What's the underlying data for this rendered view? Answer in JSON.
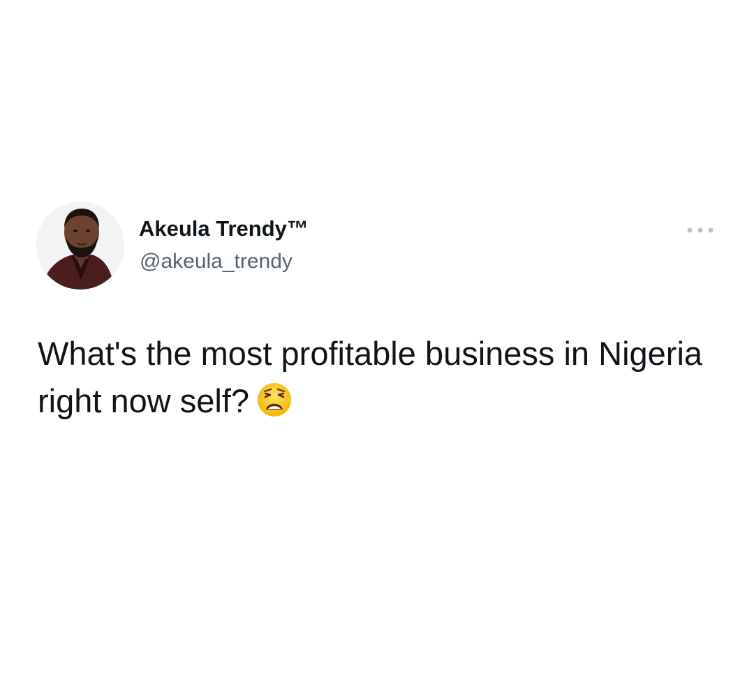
{
  "author": {
    "display_name": "Akeula Trendy™",
    "handle": "@akeula_trendy",
    "avatar_icon": "profile-photo"
  },
  "tweet": {
    "text": "What's the most profitable business in Nigeria right now self?",
    "emoji": "weary-face-icon"
  },
  "menu": {
    "icon": "more-options-icon"
  },
  "colors": {
    "text_primary": "#0f1419",
    "text_secondary": "#536471",
    "background": "#ffffff"
  }
}
